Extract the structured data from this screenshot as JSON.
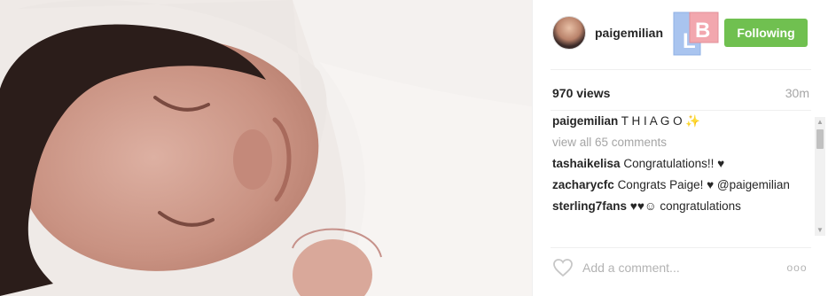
{
  "post": {
    "username": "paigemilian",
    "follow_label": "Following",
    "badge_text": "LB",
    "views": "970 views",
    "time": "30m"
  },
  "comments": {
    "caption_user": "paigemilian",
    "caption_text": "T H I A G O ✨",
    "view_all": "view all 65 comments",
    "items": [
      {
        "user": "tashaikelisa",
        "text": "Congratulations!! ♥"
      },
      {
        "user": "zacharycfc",
        "text": "Congrats Paige! ♥ @paigemilian"
      },
      {
        "user": "sterling7fans",
        "text": "♥♥☺ congratulations"
      }
    ]
  },
  "footer": {
    "comment_placeholder": "Add a comment...",
    "more_label": "ooo"
  },
  "colors": {
    "follow_button": "#70c050",
    "muted_text": "#a5a5a5",
    "badge_blue": "#a9c4ef",
    "badge_pink": "#f2a7ae"
  },
  "icons": {
    "like": "heart-icon",
    "more": "more-options-icon",
    "scroll_up": "scroll-up-icon",
    "scroll_down": "scroll-down-icon"
  }
}
